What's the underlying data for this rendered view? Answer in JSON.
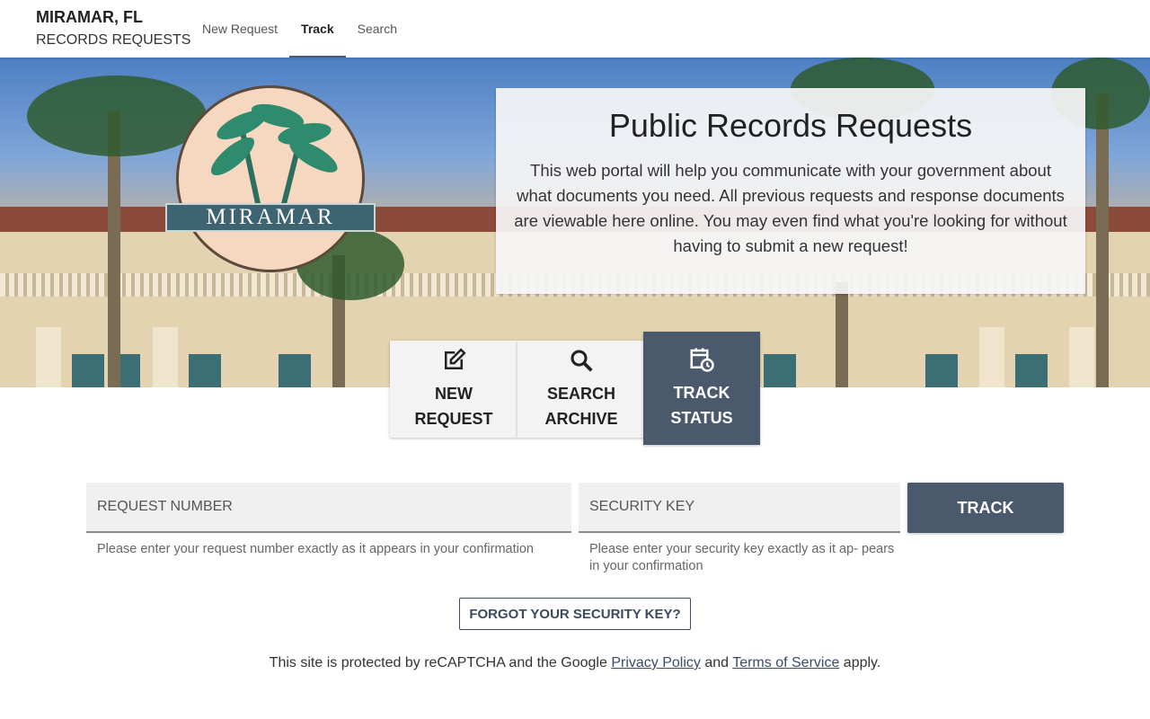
{
  "header": {
    "city": "MIRAMAR, FL",
    "subtitle": "RECORDS REQUESTS",
    "nav": [
      {
        "label": "New Request"
      },
      {
        "label": "Track"
      },
      {
        "label": "Search"
      }
    ],
    "active_nav": "Track"
  },
  "hero": {
    "logo_text": "MIRAMAR",
    "title": "Public Records Requests",
    "description": "This web portal will help you communicate with your government about what documents you need. All previous requests and response documents are viewable here online. You may even find what you're looking for without having to submit a new request!"
  },
  "tiles": [
    {
      "icon": "edit-icon",
      "line1": "NEW",
      "line2": "REQUEST"
    },
    {
      "icon": "search-icon",
      "line1": "SEARCH",
      "line2": "ARCHIVE"
    },
    {
      "icon": "calendar-clock-icon",
      "line1": "TRACK",
      "line2": "STATUS"
    }
  ],
  "track_form": {
    "request_number_placeholder": "REQUEST NUMBER",
    "request_number_hint": "Please enter your request number exactly as it appears in your confirmation",
    "security_key_placeholder": "SECURITY KEY",
    "security_key_hint": "Please enter your security key exactly as it ap- pears in your confirmation",
    "track_label": "TRACK",
    "forgot_label": "FORGOT YOUR SECURITY KEY?"
  },
  "recaptcha": {
    "prefix": "This site is protected by reCAPTCHA and the Google",
    "privacy": "Privacy Policy",
    "and": "and",
    "terms": "Terms of Service",
    "suffix": "apply."
  },
  "colors": {
    "accent": "#4a5a6c",
    "hero_card": "#f5f5f5"
  }
}
